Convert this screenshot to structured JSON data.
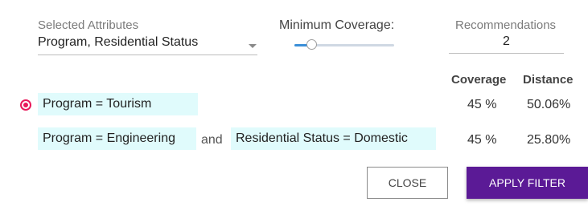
{
  "attributes": {
    "label": "Selected Attributes",
    "value": "Program, Residential Status"
  },
  "coverage": {
    "label": "Minimum Coverage:",
    "level": 0.17
  },
  "recommendations": {
    "label": "Recommendations",
    "value": "2"
  },
  "table": {
    "headers": {
      "coverage": "Coverage",
      "distance": "Distance"
    },
    "rows": [
      {
        "selected": true,
        "chips": [
          "Program = Tourism"
        ],
        "coverage": "45 %",
        "distance": "50.06%"
      },
      {
        "selected": false,
        "chips": [
          "Program = Engineering",
          "Residential Status = Domestic"
        ],
        "joiner": "and",
        "coverage": "45 %",
        "distance": "25.80%"
      }
    ]
  },
  "buttons": {
    "close": "CLOSE",
    "apply": "APPLY FILTER"
  },
  "colors": {
    "accent": "#5b1a96",
    "chip": "#e0fbfc",
    "radio": "#e8195a",
    "slider": "#3b8fd8"
  }
}
